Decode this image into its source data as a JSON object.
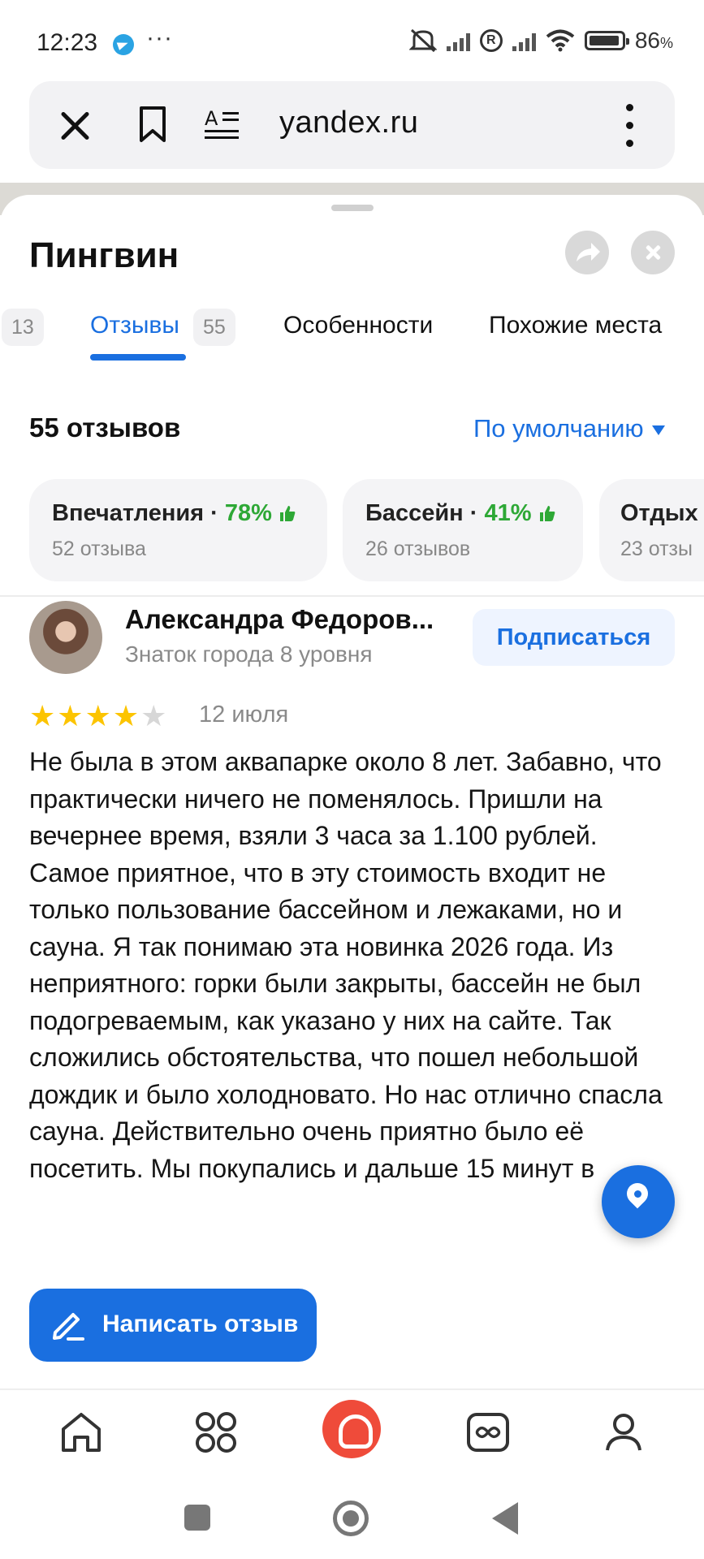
{
  "status_bar": {
    "time": "12:23",
    "dots": "···",
    "battery_percent": "86",
    "battery_unit": "%",
    "icons": [
      "telegram-icon",
      "mute-icon",
      "signal-icon",
      "roaming-icon",
      "wifi-icon",
      "battery-icon"
    ]
  },
  "browser": {
    "url": "yandex.ru",
    "icons": [
      "close-icon",
      "bookmark-icon",
      "reader-icon",
      "more-icon"
    ]
  },
  "place": {
    "title": "Пингвин"
  },
  "tabs": [
    {
      "badge": "13"
    },
    {
      "label": "Отзывы",
      "badge": "55",
      "active": true
    },
    {
      "label": "Особенности"
    },
    {
      "label": "Похожие места"
    }
  ],
  "reviews": {
    "count_label": "55 отзывов",
    "sort_label": "По умолчанию"
  },
  "aspects": [
    {
      "name": "Впечатления",
      "sep": " · ",
      "pct": "78%",
      "sub": "52 отзыва"
    },
    {
      "name": "Бассейн",
      "sep": " · ",
      "pct": "41%",
      "sub": "26 отзывов"
    },
    {
      "name": "Отдых",
      "sub": "23 отзы"
    }
  ],
  "review": {
    "author": "Александра Федоров...",
    "level": "Знаток города 8 уровня",
    "subscribe_label": "Подписаться",
    "rating": 4,
    "rating_max": 5,
    "date": "12 июля",
    "text": "Не была в этом аквапарке около 8 лет. Забавно, что практически ничего не поменялось. Пришли на вечернее время, взяли 3 часа за 1.100 рублей. Самое приятное, что в эту стоимость входит не только пользование бассейном и лежаками, но и сауна. Я так понимаю эта новинка 2026 года. Из неприятного: горки были закрыты, бассейн не был подогреваемым, как указано у них на сайте. Так сложились обстоятельства, что пошел небольшой дождик и было холодновато. Но нас отлично спасла сауна. Действительно очень приятно было её посетить. Мы покупались и дальше 15 минут в"
  },
  "actions": {
    "write_review": "Написать отзыв"
  },
  "colors": {
    "accent": "#1a6fe0",
    "positive": "#2ea836",
    "star": "#fcc400",
    "alice": "#ef4b3a"
  },
  "bottom_nav": [
    "home-icon",
    "apps-icon",
    "alice-icon",
    "media-icon",
    "profile-icon"
  ]
}
